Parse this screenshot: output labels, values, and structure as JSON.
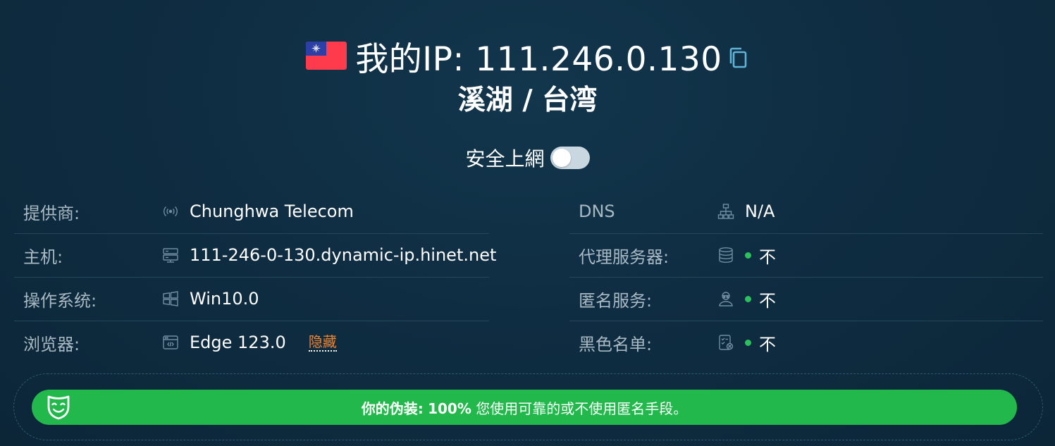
{
  "header": {
    "ip_label": "我的IP:",
    "ip_address": "111.246.0.130",
    "location": "溪湖 / 台湾",
    "flag_icon": "taiwan-flag-icon",
    "copy_icon": "copy-icon"
  },
  "safe_browsing": {
    "label": "安全上網",
    "enabled": false
  },
  "left_rows": [
    {
      "label": "提供商:",
      "icon": "antenna-icon",
      "value": "Chunghwa Telecom"
    },
    {
      "label": "主机:",
      "icon": "server-icon",
      "value": "111-246-0-130.dynamic-ip.hinet.net"
    },
    {
      "label": "操作系统:",
      "icon": "windows-icon",
      "value": "Win10.0"
    },
    {
      "label": "浏览器:",
      "icon": "browser-icon",
      "value": "Edge 123.0",
      "link": "隐藏"
    }
  ],
  "right_rows": [
    {
      "label": "DNS",
      "icon": "network-icon",
      "value": "N/A"
    },
    {
      "label": "代理服务器:",
      "icon": "database-icon",
      "value": "不",
      "status": "green"
    },
    {
      "label": "匿名服务:",
      "icon": "anonymous-user-icon",
      "value": "不",
      "status": "green"
    },
    {
      "label": "黑色名单:",
      "icon": "blacklist-icon",
      "value": "不",
      "status": "green"
    }
  ],
  "disguise": {
    "label": "你的伪装:",
    "percent": "100%",
    "message": "您使用可靠的或不使用匿名手段。",
    "icon": "mask-icon"
  },
  "colors": {
    "background": "#0f2d42",
    "accent_green": "#22b84c",
    "status_dot": "#2bc25b",
    "link_orange": "#f0852f",
    "label_gray": "#a9b9c4"
  }
}
